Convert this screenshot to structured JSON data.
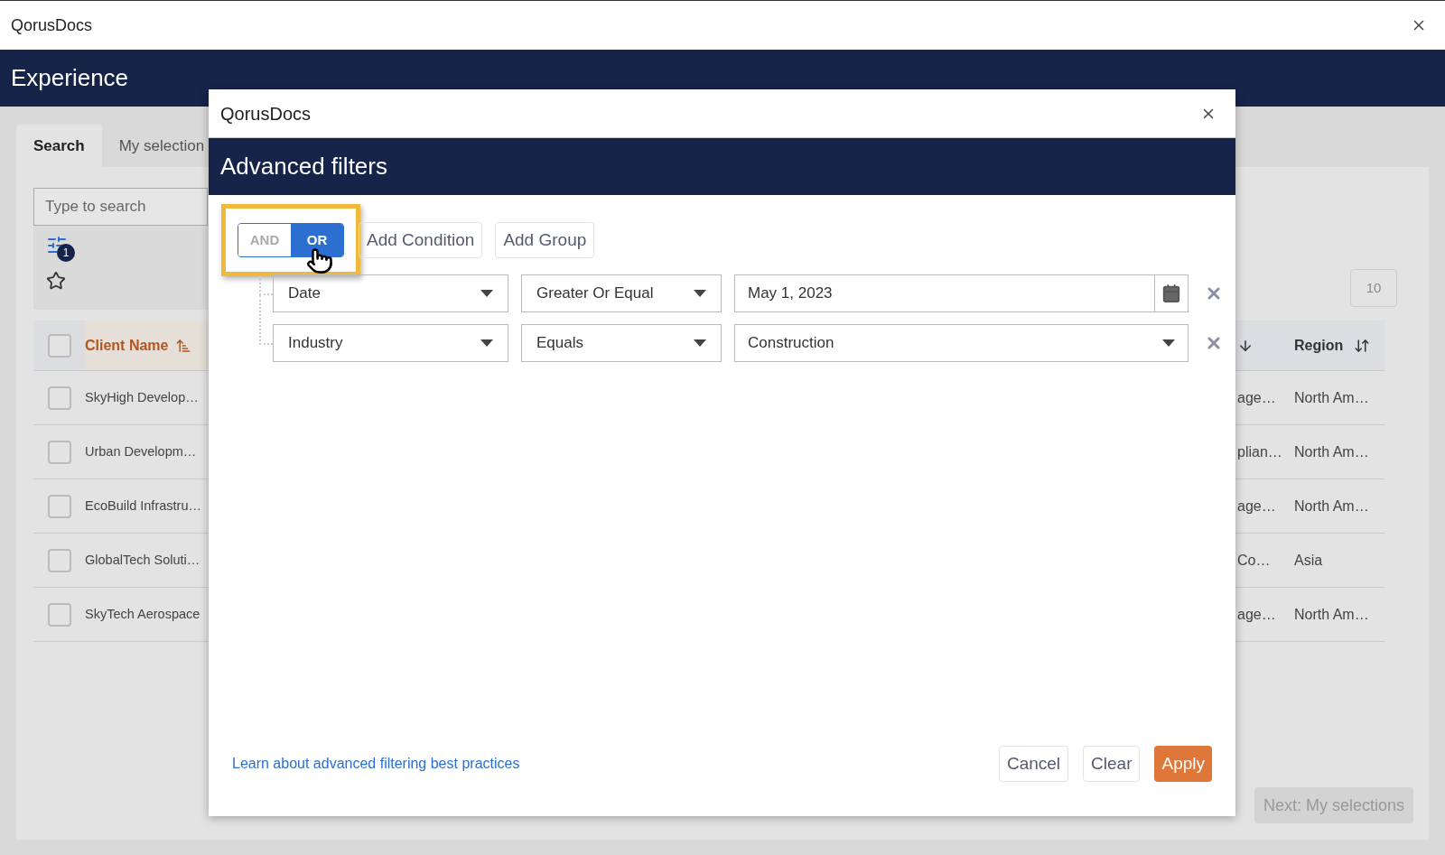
{
  "app": {
    "title": "QorusDocs",
    "header": "Experience"
  },
  "tabs": [
    {
      "label": "Search",
      "selected": true
    },
    {
      "label": "My selection",
      "selected": false
    }
  ],
  "search": {
    "placeholder": "Type to search"
  },
  "filter_badge": "1",
  "pagination": {
    "page_size": "10"
  },
  "table": {
    "select_all_checked": false,
    "columns": [
      {
        "label": "Client Name",
        "sorted": true
      },
      {
        "label": "Region",
        "sorted": false
      }
    ],
    "rows": [
      {
        "client": "SkyHigh Develop…",
        "column_3": "age…",
        "region": "North Am…",
        "checked": false
      },
      {
        "client": "Urban Developm…",
        "column_3": "plian…",
        "region": "North Am…",
        "checked": false
      },
      {
        "client": "EcoBuild Infrastru…",
        "column_3": "age…",
        "region": "North Am…",
        "checked": false
      },
      {
        "client": "GlobalTech Soluti…",
        "column_3": "Co…",
        "region": "Asia",
        "checked": false
      },
      {
        "client": "SkyTech Aerospace",
        "column_3": "age…",
        "region": "North Am…",
        "checked": false
      }
    ]
  },
  "next_button": "Next: My selections",
  "dialog": {
    "title": "QorusDocs",
    "heading": "Advanced filters",
    "logic": {
      "highlighted": true,
      "options": [
        {
          "label": "AND",
          "selected": false
        },
        {
          "label": "OR",
          "selected": true
        }
      ]
    },
    "actions": [
      "Add Condition",
      "Add Group"
    ],
    "conditions": [
      {
        "field": "Date",
        "operator": "Greater Or Equal",
        "value": "May 1, 2023",
        "kind": "date"
      },
      {
        "field": "Industry",
        "operator": "Equals",
        "value": "Construction",
        "kind": "select"
      }
    ],
    "help_link": "Learn about advanced filtering best practices",
    "buttons": [
      {
        "label": "Cancel",
        "kind": "secondary"
      },
      {
        "label": "Clear",
        "kind": "secondary"
      },
      {
        "label": "Apply",
        "kind": "primary"
      }
    ]
  }
}
